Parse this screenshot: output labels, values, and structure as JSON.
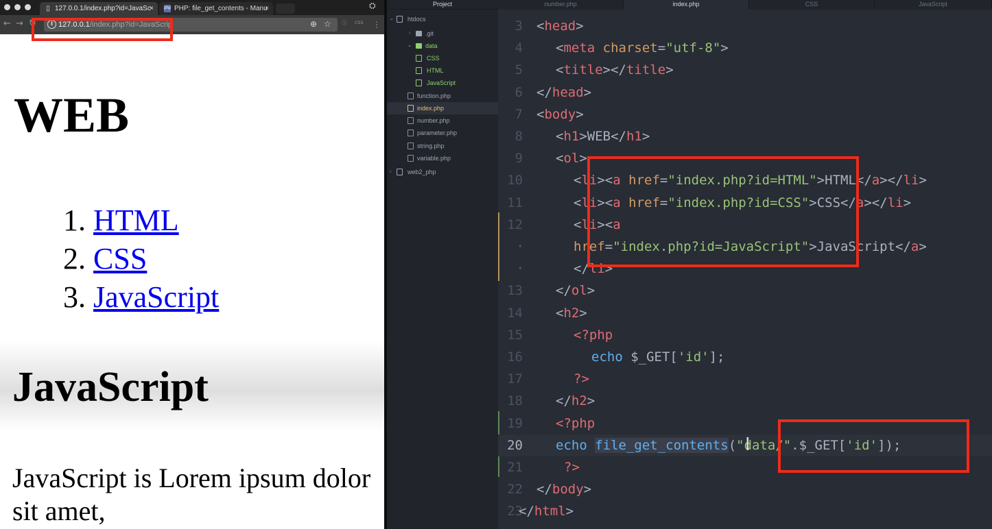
{
  "browser": {
    "tabs": [
      {
        "label": "127.0.0.1/index.php?id=JavaSc",
        "close": "×"
      },
      {
        "label": "PHP: file_get_contents - Manu",
        "close": "×",
        "favicon": "php"
      }
    ],
    "url": {
      "host": "127.0.0.1",
      "path": "/index.php?id=JavaScrip"
    },
    "page": {
      "heading": "WEB",
      "list": [
        {
          "number": "1.",
          "link": "HTML"
        },
        {
          "number": "2.",
          "link": "CSS"
        },
        {
          "number": "3.",
          "link": "JavaScript"
        }
      ],
      "subheading": "JavaScript",
      "paragraph": "JavaScript is Lorem ipsum dolor sit amet,"
    }
  },
  "editor": {
    "tree_title": "Project",
    "tree": [
      {
        "label": "htdocs",
        "arrow": "⌄",
        "icon": "repo"
      },
      {
        "label": ".git",
        "arrow": "›",
        "icon": "folder"
      },
      {
        "label": "data",
        "arrow": "⌄",
        "icon": "folder-open"
      },
      {
        "label": "CSS",
        "icon": "file"
      },
      {
        "label": "HTML",
        "icon": "file"
      },
      {
        "label": "JavaScript",
        "icon": "file"
      },
      {
        "label": "function.php",
        "icon": "file"
      },
      {
        "label": "index.php",
        "icon": "file",
        "selected": true
      },
      {
        "label": "number.php",
        "icon": "file"
      },
      {
        "label": "parameter.php",
        "icon": "file"
      },
      {
        "label": "string.php",
        "icon": "file"
      },
      {
        "label": "variable.php",
        "icon": "file"
      },
      {
        "label": "web2_php",
        "arrow": "›",
        "icon": "repo"
      }
    ],
    "tabs": [
      "number.php",
      "index.php",
      "CSS",
      "JavaScript"
    ],
    "active_tab": "index.php",
    "line_numbers": [
      "3",
      "4",
      "5",
      "6",
      "7",
      "8",
      "9",
      "10",
      "11",
      "12",
      "•",
      "•",
      "13",
      "14",
      "15",
      "16",
      "17",
      "18",
      "19",
      "20",
      "21",
      "22",
      "23"
    ],
    "code_lines": [
      "<head>",
      "<meta charset=\"utf-8\">",
      "<title></title>",
      "</head>",
      "<body>",
      "<h1>WEB</h1>",
      "<ol>",
      "<li><a href=\"index.php?id=HTML\">HTML</a></li>",
      "<li><a href=\"index.php?id=CSS\">CSS</a></li>",
      "<li><a",
      "href=\"index.php?id=JavaScript\">JavaScript</a>",
      "</li>",
      "</ol>",
      "<h2>",
      "<?php",
      "echo $_GET['id'];",
      "?>",
      "</h2>",
      "<?php",
      "echo file_get_contents(\"data/\".$_GET['id']);",
      "?>",
      "</body>",
      "</html>"
    ]
  },
  "colors": {
    "tag": "#e06c75",
    "attribute": "#d19a66",
    "string": "#98c379",
    "function": "#61afef",
    "highlight_box": "#ee2b1a",
    "link": "#0000ee"
  }
}
